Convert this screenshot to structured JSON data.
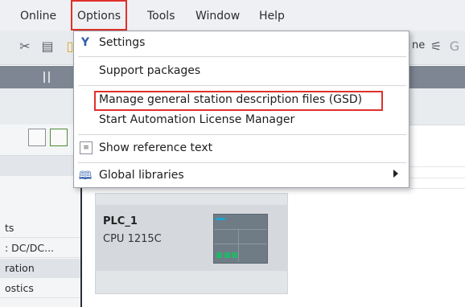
{
  "menubar": {
    "items": [
      "Online",
      "Options",
      "Tools",
      "Window",
      "Help"
    ],
    "active": "Options"
  },
  "toolbar": {
    "right_text": "ne"
  },
  "dropdown": {
    "items": [
      {
        "label": "Settings",
        "icon": "wrench-icon"
      },
      {
        "label": "Support packages",
        "icon": ""
      },
      {
        "label": "Manage general station description files (GSD)",
        "icon": "",
        "highlighted": true
      },
      {
        "label": "Start Automation License Manager",
        "icon": ""
      },
      {
        "label": "Show reference text",
        "icon": "reference-text-icon"
      },
      {
        "label": "Global libraries",
        "icon": "book-icon",
        "submenu": true
      }
    ]
  },
  "left_panel": {
    "rows": [
      "ts",
      ": DC/DC...",
      "ration",
      "ostics"
    ],
    "selected_index": 2
  },
  "device": {
    "name": "PLC_1",
    "type": "CPU 1215C"
  },
  "colors": {
    "highlight": "#e0302b",
    "menubar_bg": "#eef0f3",
    "darkbar_bg": "#7d8692",
    "module_led": "#27b36a"
  }
}
